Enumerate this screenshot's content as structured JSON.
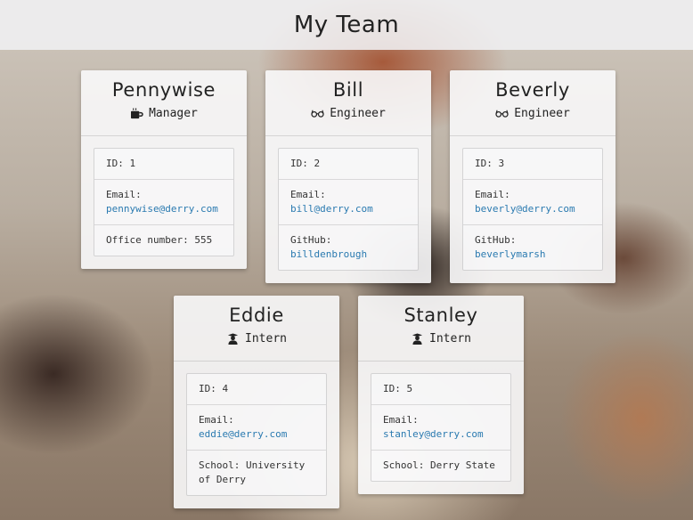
{
  "page": {
    "title": "My Team"
  },
  "colors": {
    "link": "#2a7ab0",
    "header_bg": "#f0f0f3",
    "card_bg": "#f8f8f9"
  },
  "team": [
    {
      "name": "Pennywise",
      "role": "Manager",
      "role_icon": "mug-icon",
      "id_text": "ID: 1",
      "email_label": "Email:",
      "email": "pennywise@derry.com",
      "extra_text": "Office number: 555"
    },
    {
      "name": "Bill",
      "role": "Engineer",
      "role_icon": "glasses-icon",
      "id_text": "ID: 2",
      "email_label": "Email:",
      "email": "bill@derry.com",
      "extra_label": "GitHub:",
      "extra_link": "billdenbrough"
    },
    {
      "name": "Beverly",
      "role": "Engineer",
      "role_icon": "glasses-icon",
      "id_text": "ID: 3",
      "email_label": "Email:",
      "email": "beverly@derry.com",
      "extra_label": "GitHub:",
      "extra_link": "beverlymarsh"
    },
    {
      "name": "Eddie",
      "role": "Intern",
      "role_icon": "graduate-icon",
      "id_text": "ID: 4",
      "email_label": "Email:",
      "email": "eddie@derry.com",
      "extra_text": "School: University of Derry"
    },
    {
      "name": "Stanley",
      "role": "Intern",
      "role_icon": "graduate-icon",
      "id_text": "ID: 5",
      "email_label": "Email:",
      "email": "stanley@derry.com",
      "extra_text": "School: Derry State"
    }
  ]
}
